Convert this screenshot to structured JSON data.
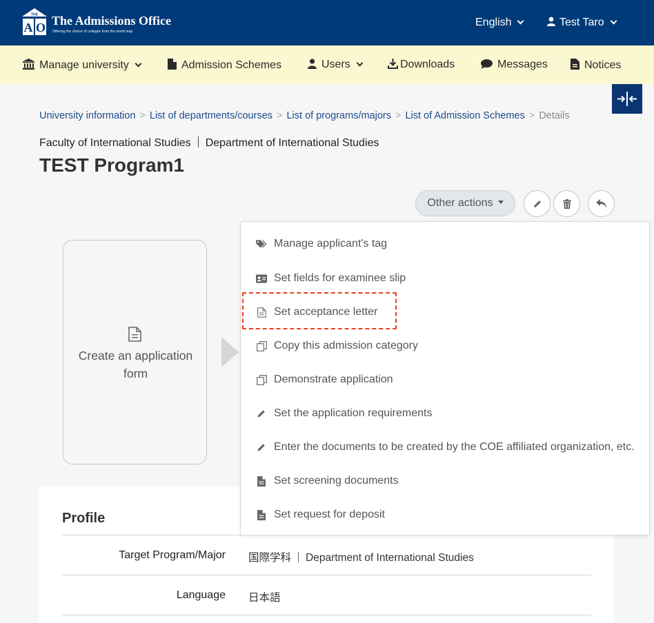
{
  "header": {
    "brand_title": "The Admissions Office",
    "brand_subtitle": "Offering the choice of colleges from the world map",
    "logo_text_top": "THE",
    "logo_letters": "AO",
    "language": "English",
    "user_name": "Test Taro"
  },
  "nav": {
    "manage_university": "Manage university",
    "admission_schemes": "Admission Schemes",
    "users": "Users",
    "downloads": "Downloads",
    "messages": "Messages",
    "notices": "Notices"
  },
  "breadcrumb": {
    "items": [
      "University information",
      "List of departments/courses",
      "List of programs/majors",
      "List of Admission Schemes"
    ],
    "current": "Details",
    "separator": ">"
  },
  "page": {
    "faculty": "Faculty of International Studies",
    "department": "Department of International Studies",
    "title": "TEST Program1"
  },
  "actions": {
    "other_actions": "Other actions"
  },
  "create_card": {
    "label": "Create an application form"
  },
  "dropdown": {
    "items": [
      {
        "label": "Manage applicant's tag",
        "icon": "tags-icon"
      },
      {
        "label": "Set fields for examinee slip",
        "icon": "id-card-icon"
      },
      {
        "label": "Set acceptance letter",
        "icon": "document-outline-icon"
      },
      {
        "label": "Copy this admission category",
        "icon": "copy-icon"
      },
      {
        "label": "Demonstrate application",
        "icon": "copy-icon"
      },
      {
        "label": "Set the application requirements",
        "icon": "pencil-icon"
      },
      {
        "label": "Enter the documents to be created by the COE affiliated organization, etc.",
        "icon": "pencil-icon"
      },
      {
        "label": "Set screening documents",
        "icon": "document-filled-icon"
      },
      {
        "label": "Set request for deposit",
        "icon": "document-filled-icon"
      }
    ]
  },
  "profile": {
    "title": "Profile",
    "rows": [
      {
        "label": "Target Program/Major",
        "value_a": "国際学科",
        "value_b": "Department of International Studies"
      },
      {
        "label": "Language",
        "value_a": "日本語"
      }
    ]
  },
  "colors": {
    "header_bg": "#003a79",
    "nav_bg": "#fbf7d0",
    "link": "#1d4b8a",
    "highlight": "#e8401c"
  }
}
